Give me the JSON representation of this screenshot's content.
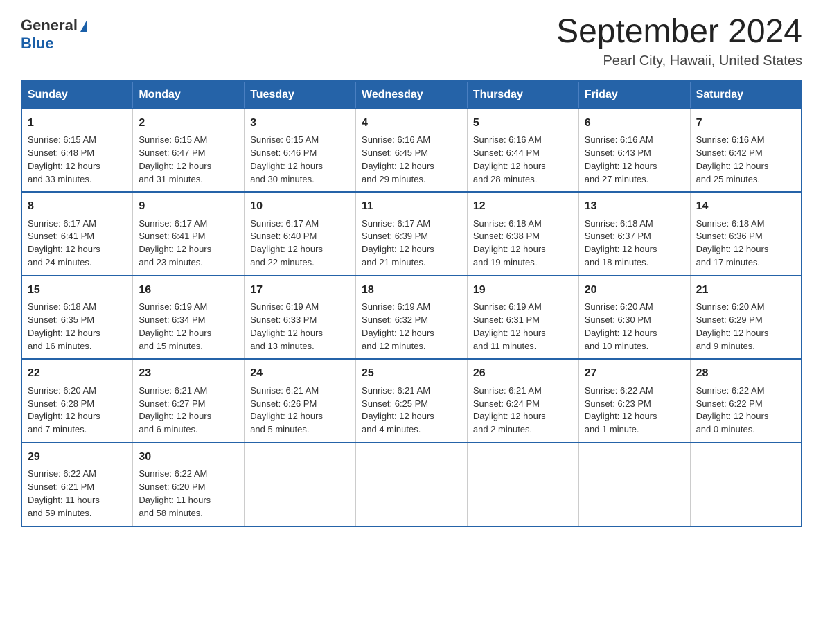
{
  "logo": {
    "general": "General",
    "blue": "Blue"
  },
  "title": "September 2024",
  "location": "Pearl City, Hawaii, United States",
  "days_header": [
    "Sunday",
    "Monday",
    "Tuesday",
    "Wednesday",
    "Thursday",
    "Friday",
    "Saturday"
  ],
  "weeks": [
    [
      {
        "day": "1",
        "sunrise": "6:15 AM",
        "sunset": "6:48 PM",
        "daylight": "12 hours and 33 minutes."
      },
      {
        "day": "2",
        "sunrise": "6:15 AM",
        "sunset": "6:47 PM",
        "daylight": "12 hours and 31 minutes."
      },
      {
        "day": "3",
        "sunrise": "6:15 AM",
        "sunset": "6:46 PM",
        "daylight": "12 hours and 30 minutes."
      },
      {
        "day": "4",
        "sunrise": "6:16 AM",
        "sunset": "6:45 PM",
        "daylight": "12 hours and 29 minutes."
      },
      {
        "day": "5",
        "sunrise": "6:16 AM",
        "sunset": "6:44 PM",
        "daylight": "12 hours and 28 minutes."
      },
      {
        "day": "6",
        "sunrise": "6:16 AM",
        "sunset": "6:43 PM",
        "daylight": "12 hours and 27 minutes."
      },
      {
        "day": "7",
        "sunrise": "6:16 AM",
        "sunset": "6:42 PM",
        "daylight": "12 hours and 25 minutes."
      }
    ],
    [
      {
        "day": "8",
        "sunrise": "6:17 AM",
        "sunset": "6:41 PM",
        "daylight": "12 hours and 24 minutes."
      },
      {
        "day": "9",
        "sunrise": "6:17 AM",
        "sunset": "6:41 PM",
        "daylight": "12 hours and 23 minutes."
      },
      {
        "day": "10",
        "sunrise": "6:17 AM",
        "sunset": "6:40 PM",
        "daylight": "12 hours and 22 minutes."
      },
      {
        "day": "11",
        "sunrise": "6:17 AM",
        "sunset": "6:39 PM",
        "daylight": "12 hours and 21 minutes."
      },
      {
        "day": "12",
        "sunrise": "6:18 AM",
        "sunset": "6:38 PM",
        "daylight": "12 hours and 19 minutes."
      },
      {
        "day": "13",
        "sunrise": "6:18 AM",
        "sunset": "6:37 PM",
        "daylight": "12 hours and 18 minutes."
      },
      {
        "day": "14",
        "sunrise": "6:18 AM",
        "sunset": "6:36 PM",
        "daylight": "12 hours and 17 minutes."
      }
    ],
    [
      {
        "day": "15",
        "sunrise": "6:18 AM",
        "sunset": "6:35 PM",
        "daylight": "12 hours and 16 minutes."
      },
      {
        "day": "16",
        "sunrise": "6:19 AM",
        "sunset": "6:34 PM",
        "daylight": "12 hours and 15 minutes."
      },
      {
        "day": "17",
        "sunrise": "6:19 AM",
        "sunset": "6:33 PM",
        "daylight": "12 hours and 13 minutes."
      },
      {
        "day": "18",
        "sunrise": "6:19 AM",
        "sunset": "6:32 PM",
        "daylight": "12 hours and 12 minutes."
      },
      {
        "day": "19",
        "sunrise": "6:19 AM",
        "sunset": "6:31 PM",
        "daylight": "12 hours and 11 minutes."
      },
      {
        "day": "20",
        "sunrise": "6:20 AM",
        "sunset": "6:30 PM",
        "daylight": "12 hours and 10 minutes."
      },
      {
        "day": "21",
        "sunrise": "6:20 AM",
        "sunset": "6:29 PM",
        "daylight": "12 hours and 9 minutes."
      }
    ],
    [
      {
        "day": "22",
        "sunrise": "6:20 AM",
        "sunset": "6:28 PM",
        "daylight": "12 hours and 7 minutes."
      },
      {
        "day": "23",
        "sunrise": "6:21 AM",
        "sunset": "6:27 PM",
        "daylight": "12 hours and 6 minutes."
      },
      {
        "day": "24",
        "sunrise": "6:21 AM",
        "sunset": "6:26 PM",
        "daylight": "12 hours and 5 minutes."
      },
      {
        "day": "25",
        "sunrise": "6:21 AM",
        "sunset": "6:25 PM",
        "daylight": "12 hours and 4 minutes."
      },
      {
        "day": "26",
        "sunrise": "6:21 AM",
        "sunset": "6:24 PM",
        "daylight": "12 hours and 2 minutes."
      },
      {
        "day": "27",
        "sunrise": "6:22 AM",
        "sunset": "6:23 PM",
        "daylight": "12 hours and 1 minute."
      },
      {
        "day": "28",
        "sunrise": "6:22 AM",
        "sunset": "6:22 PM",
        "daylight": "12 hours and 0 minutes."
      }
    ],
    [
      {
        "day": "29",
        "sunrise": "6:22 AM",
        "sunset": "6:21 PM",
        "daylight": "11 hours and 59 minutes."
      },
      {
        "day": "30",
        "sunrise": "6:22 AM",
        "sunset": "6:20 PM",
        "daylight": "11 hours and 58 minutes."
      },
      null,
      null,
      null,
      null,
      null
    ]
  ],
  "labels": {
    "sunrise": "Sunrise:",
    "sunset": "Sunset:",
    "daylight": "Daylight:"
  }
}
